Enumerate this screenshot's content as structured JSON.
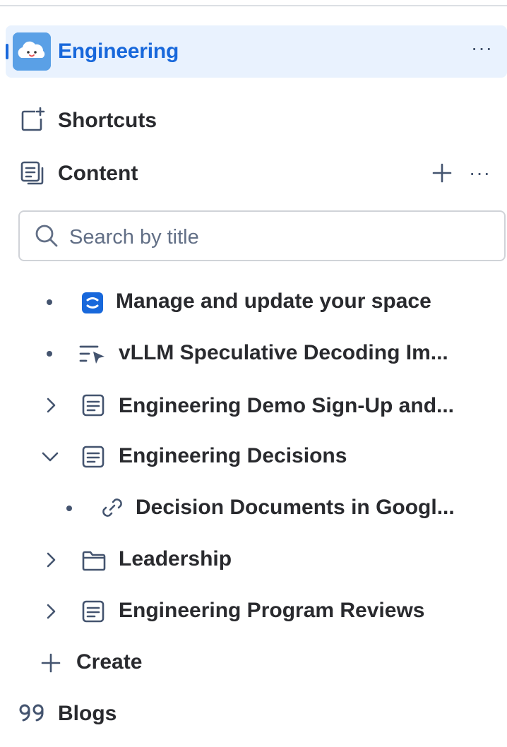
{
  "space": {
    "title": "Engineering",
    "more_label": "···"
  },
  "nav": {
    "shortcuts_label": "Shortcuts",
    "content_label": "Content",
    "content_add_label": "+",
    "content_more_label": "···"
  },
  "search": {
    "placeholder": "Search by title"
  },
  "tree": {
    "items": [
      {
        "label": "Manage and update your space",
        "icon": "confluence-space-icon",
        "toggle": "bullet"
      },
      {
        "label": "vLLM Speculative Decoding Im...",
        "icon": "live-doc-icon",
        "toggle": "bullet"
      },
      {
        "label": "Engineering Demo Sign-Up and...",
        "icon": "page-icon",
        "toggle": "collapsed"
      },
      {
        "label": "Engineering Decisions",
        "icon": "page-icon",
        "toggle": "expanded"
      },
      {
        "label": "Decision Documents in Googl...",
        "icon": "link-icon",
        "toggle": "bullet"
      },
      {
        "label": "Leadership",
        "icon": "folder-icon",
        "toggle": "collapsed"
      },
      {
        "label": "Engineering Program Reviews",
        "icon": "page-icon",
        "toggle": "collapsed"
      }
    ]
  },
  "create_label": "Create",
  "blogs_label": "Blogs",
  "colors": {
    "accent": "#1868db",
    "selected_bg": "#e9f2fe",
    "text": "#292a2e",
    "icon": "#44546f"
  }
}
